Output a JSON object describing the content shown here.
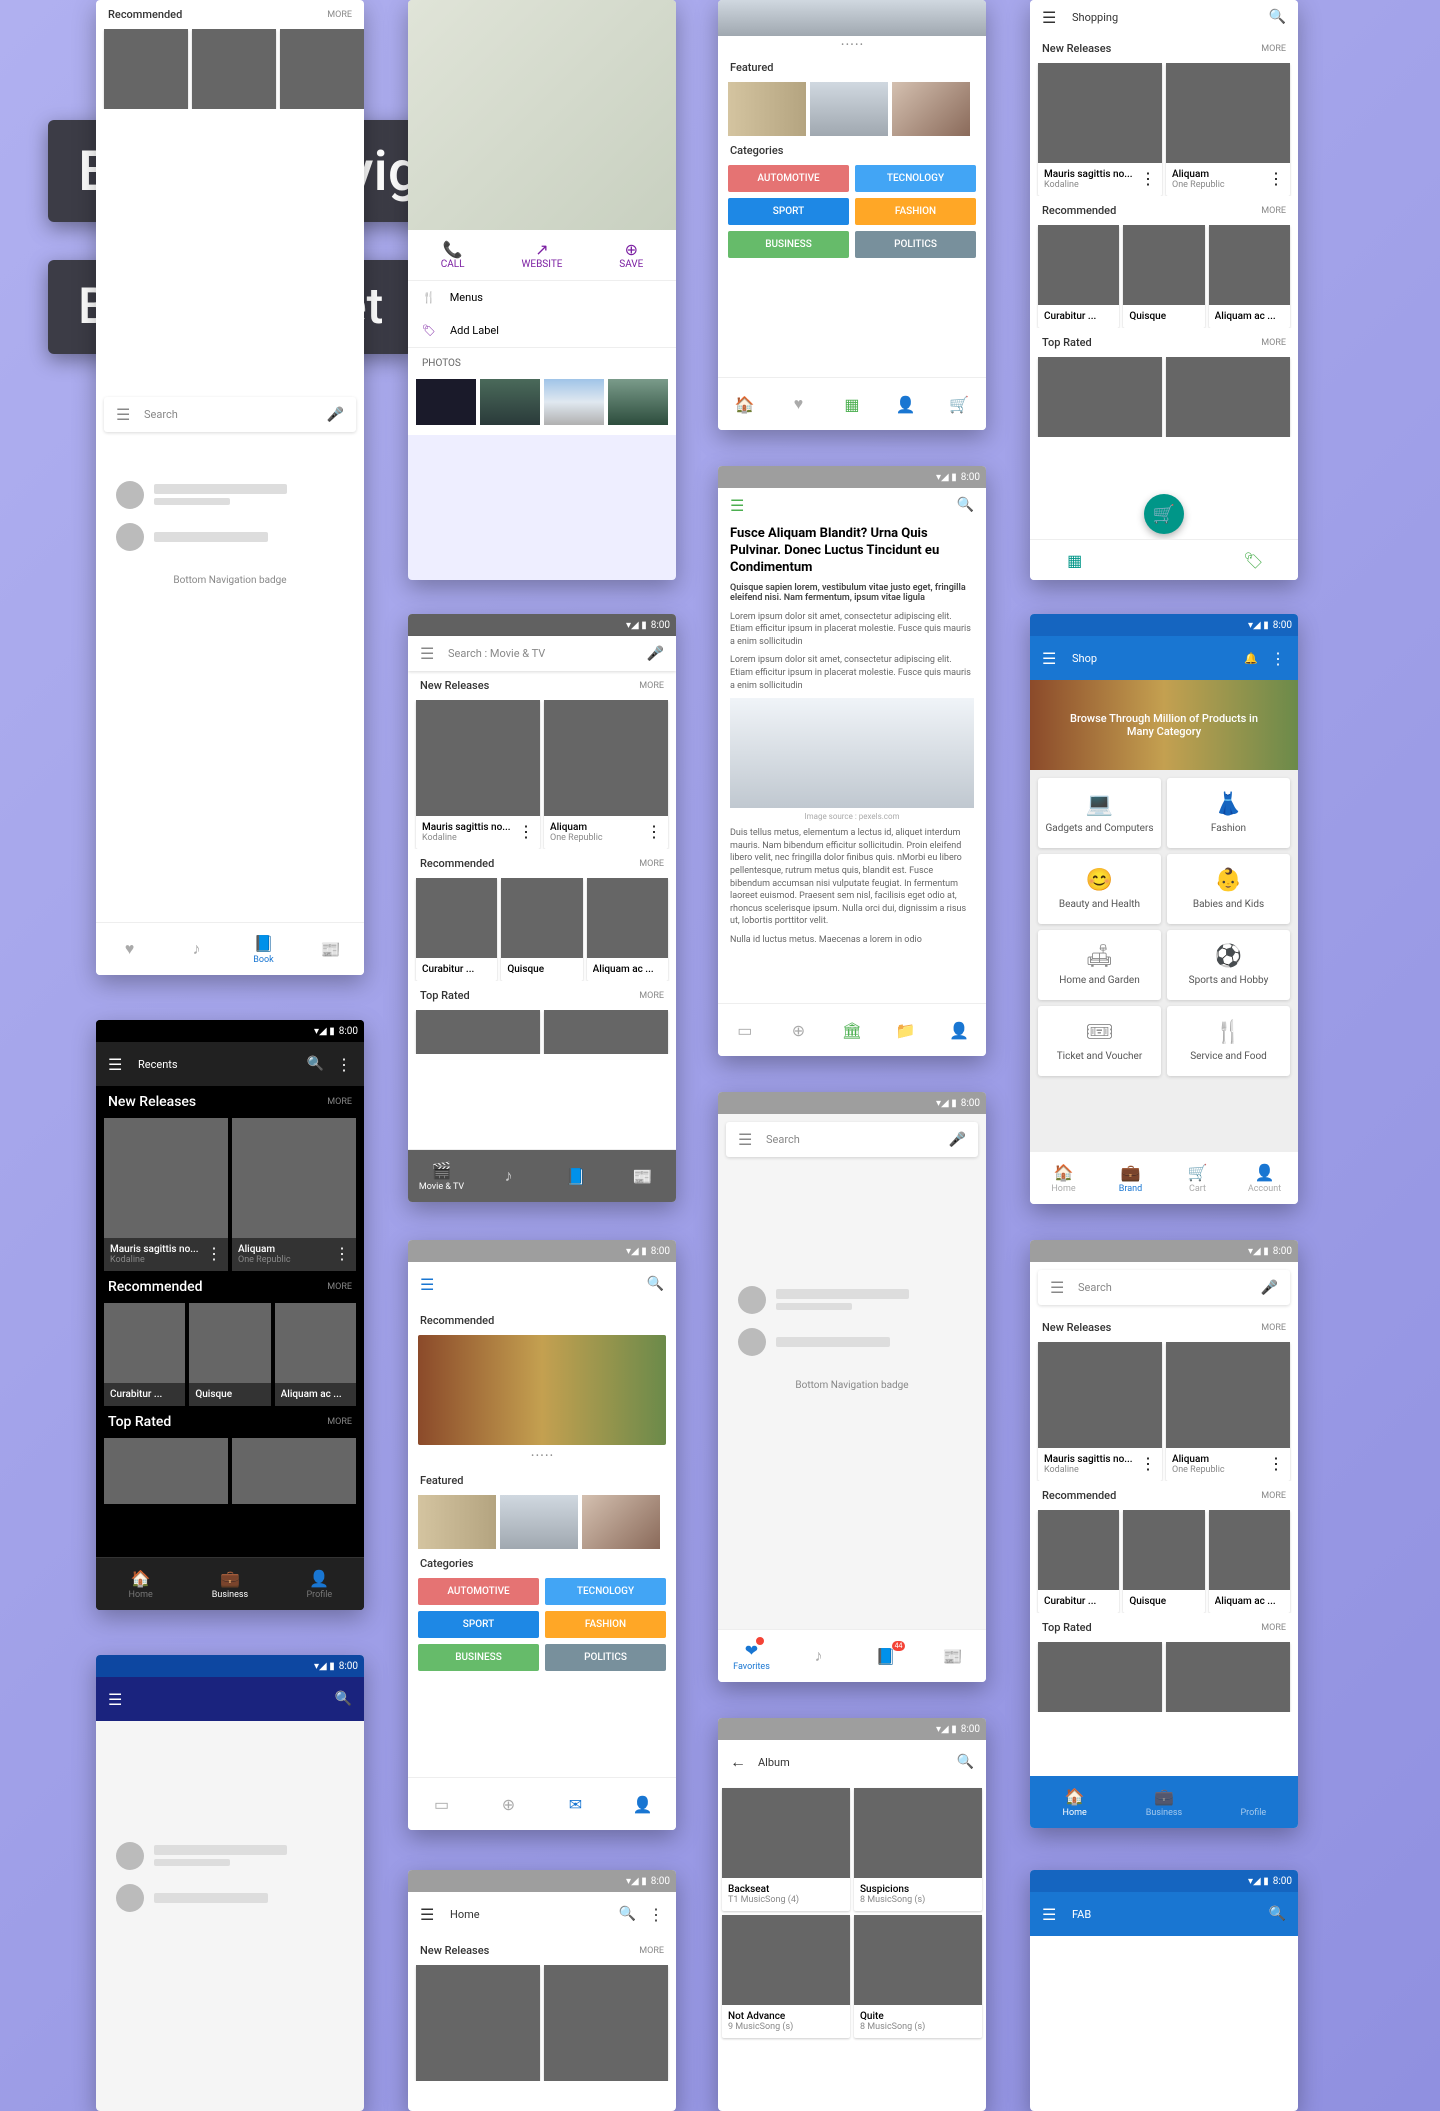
{
  "labels": {
    "overlay1": "Bottom Navigation",
    "overlay2": "Bottom Sheet",
    "recommended": "Recommended",
    "featured": "Featured",
    "new_releases": "New Releases",
    "top_rated": "Top Rated",
    "more": "MORE",
    "categories": "Categories",
    "search": "Search",
    "shopping": "Shopping",
    "shop": "Shop",
    "home": "Home",
    "fab": "FAB",
    "album": "Album",
    "recents": "Recents",
    "search_movie": "Search : Movie & TV",
    "badge_label": "Bottom Navigation badge",
    "photos": "PHOTOS",
    "menus": "Menus",
    "add_label": "Add Label",
    "call": "CALL",
    "website": "WEBSITE",
    "save": "SAVE",
    "image_source": "Image source : pexels.com",
    "browse": "Browse Through Million of Products in Many Category",
    "time": "8:00"
  },
  "items": {
    "mauris": "Mauris sagittis no...",
    "kodaline": "Kodaline",
    "aliquam": "Aliquam",
    "one_republic": "One Republic",
    "curabitur": "Curabitur ...",
    "quisque": "Quisque",
    "aliquam_ac": "Aliquam ac ...",
    "backseat": "Backseat",
    "suspicions": "Suspicions",
    "not_advance": "Not Advance",
    "quite": "Quite",
    "t1": "T1 MusicSong (4)",
    "t8": "8 MusicSong (s)",
    "t9": "9 MusicSong (s)"
  },
  "cats": {
    "automotive": "AUTOMOTIVE",
    "tecnology": "TECNOLOGY",
    "sport": "SPORT",
    "fashion": "FASHION",
    "business": "BUSINESS",
    "politics": "POLITICS"
  },
  "shop_cats": {
    "gadgets": "Gadgets and Computers",
    "fashion": "Fashion",
    "beauty": "Beauty and Health",
    "babies": "Babies and Kids",
    "home": "Home and Garden",
    "sports": "Sports and Hobby",
    "ticket": "Ticket and Voucher",
    "food": "Service and Food"
  },
  "nav": {
    "book": "Book",
    "movie_tv": "Movie & TV",
    "home": "Home",
    "business": "Business",
    "profile": "Profile",
    "favorites": "Favorites",
    "brand": "Brand",
    "cart": "Cart",
    "account": "Account"
  },
  "article": {
    "title": "Fusce Aliquam Blandit? Urna Quis Pulvinar. Donec Luctus Tincidunt eu Condimentum",
    "lead": "Quisque sapien lorem, vestibulum vitae justo eget, fringilla eleifend nisi. Nam fermentum, ipsum vitae ligula",
    "p1": "Lorem ipsum dolor sit amet, consectetur adipiscing elit. Etiam efficitur ipsum in placerat molestie. Fusce quis mauris a enim sollicitudin",
    "p2": "Lorem ipsum dolor sit amet, consectetur adipiscing elit. Etiam efficitur ipsum in placerat molestie. Fusce quis mauris a enim sollicitudin",
    "p3": "Duis tellus metus, elementum a lectus id, aliquet interdum mauris. Nam bibendum efficitur sollicitudin. Proin eleifend libero velit, nec fringilla dolor finibus quis. nMorbi eu libero pellentesque, rutrum metus quis, blandit est. Fusce bibendum accumsan nisi vulputate feugiat. In fermentum laoreet euismod. Praesent sem nisl, facilisis eget odio at, rhoncus scelerisque ipsum. Nulla orci dui, dignissim a risus ut, lobortis porttitor velit.",
    "p4": "Nulla id luctus metus. Maecenas a lorem in odio"
  }
}
